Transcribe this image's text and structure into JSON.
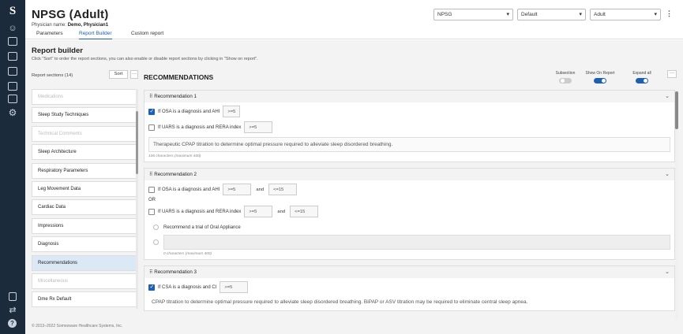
{
  "app": {
    "logo": "S"
  },
  "header": {
    "title": "NPSG (Adult)",
    "physician_label": "Physician name:",
    "physician_name": "Demo, Physician1"
  },
  "selects": {
    "study": "NPSG",
    "template": "Default",
    "population": "Adult"
  },
  "tabs": [
    "Parameters",
    "Report Builder",
    "Custom report"
  ],
  "report_builder": {
    "title": "Report builder",
    "description": "Click \"Sort\" to order the report sections, you can also enable or disable report sections by clicking in \"Show on report\".",
    "sections_count": "Report sections (14)",
    "sort_label": "Sort",
    "dots": "···",
    "sections": [
      {
        "label": "Medications",
        "state": "dim"
      },
      {
        "label": "Sleep Study Techniques",
        "state": "normal"
      },
      {
        "label": "Technical Comments",
        "state": "dim"
      },
      {
        "label": "Sleep Architecture",
        "state": "normal"
      },
      {
        "label": "Respiratory Parameters",
        "state": "normal"
      },
      {
        "label": "Leg Movement Data",
        "state": "normal"
      },
      {
        "label": "Cardiac Data",
        "state": "normal"
      },
      {
        "label": "Impressions",
        "state": "normal"
      },
      {
        "label": "Diagnosis",
        "state": "normal"
      },
      {
        "label": "Recommendations",
        "state": "selected"
      },
      {
        "label": "Miscellaneous",
        "state": "dim"
      },
      {
        "label": "Dme Rx Default",
        "state": "normal"
      }
    ]
  },
  "recommendations": {
    "heading": "RECOMMENDATIONS",
    "toggles": {
      "subsection": "Subsection",
      "show_on_report": "Show On Report",
      "expand_all": "Expand all",
      "subsection_on": false,
      "show_on_report_on": true,
      "expand_all_on": true
    },
    "cards": {
      "r1": {
        "title": "Recommendation 1",
        "osa_label": "If OSA is a diagnosis and AHI",
        "osa_value": ">=5",
        "osa_checked": true,
        "uars_label": "If UARS is a diagnosis and RERA index",
        "uars_value": ">=5",
        "uars_checked": false,
        "text": "Therapeutic CPAP titration to determine optimal pressure required to alleviate sleep disordered breathing.",
        "count": "106 characters (maximum 400)"
      },
      "r2": {
        "title": "Recommendation 2",
        "osa_label": "If OSA is a diagnosis and AHI",
        "osa_min": ">=5",
        "and1": "and",
        "osa_max": "<=15",
        "or_label": "OR",
        "uars_label": "If UARS is a diagnosis and RERA index",
        "uars_min": ">=5",
        "and2": "and",
        "uars_max": "<=15",
        "radio_label": "Recommend a trial of Oral Appliance",
        "count": "0 characters (maximum 400)"
      },
      "r3": {
        "title": "Recommendation 3",
        "csa_label": "If CSA is a diagnosis and CI",
        "csa_value": ">=5",
        "csa_checked": true,
        "text": "CPAP titration to determine optimal pressure required to alleviate sleep disordered breathing. BiPAP or ASV titration may be required to eliminate central sleep apnea."
      }
    }
  },
  "footer": "© 2013–2022 Somnoware Healthcare Systems, Inc."
}
